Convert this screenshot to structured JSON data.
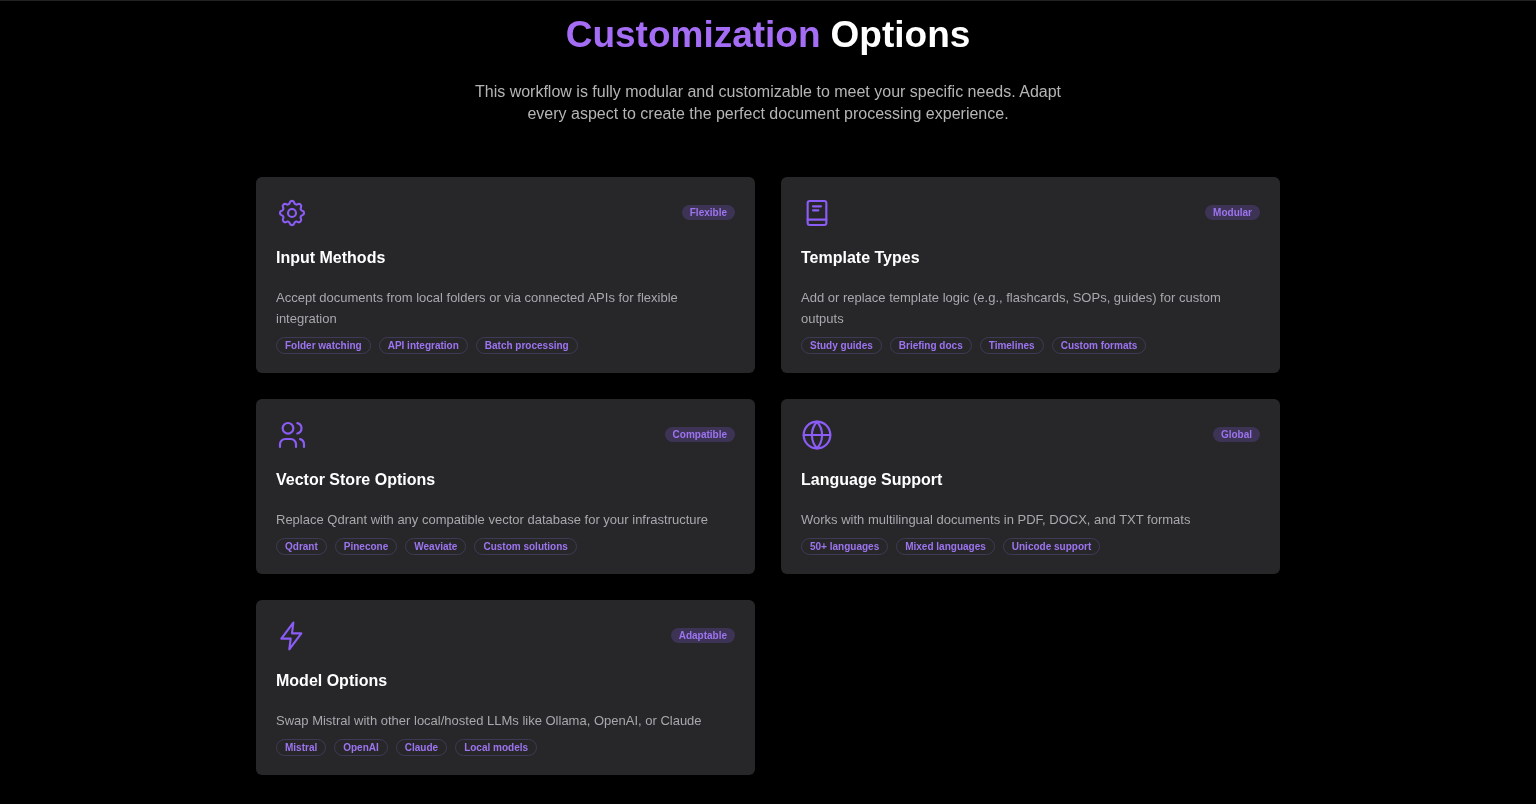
{
  "heading": {
    "highlight": "Customization",
    "rest": "Options"
  },
  "intro": "This workflow is fully modular and customizable to meet your specific needs. Adapt every aspect to create the perfect document processing experience.",
  "cards": [
    {
      "kind": "gear",
      "badge": "Flexible",
      "title": "Input Methods",
      "description": "Accept documents from local folders or via connected APIs for flexible integration",
      "tags": [
        "Folder watching",
        "API integration",
        "Batch processing"
      ]
    },
    {
      "kind": "book",
      "badge": "Modular",
      "title": "Template Types",
      "description": "Add or replace template logic (e.g., flashcards, SOPs, guides) for custom outputs",
      "tags": [
        "Study guides",
        "Briefing docs",
        "Timelines",
        "Custom formats"
      ]
    },
    {
      "kind": "users",
      "badge": "Compatible",
      "title": "Vector Store Options",
      "description": "Replace Qdrant with any compatible vector database for your infrastructure",
      "tags": [
        "Qdrant",
        "Pinecone",
        "Weaviate",
        "Custom solutions"
      ]
    },
    {
      "kind": "globe",
      "badge": "Global",
      "title": "Language Support",
      "description": "Works with multilingual documents in PDF, DOCX, and TXT formats",
      "tags": [
        "50+ languages",
        "Mixed languages",
        "Unicode support"
      ]
    },
    {
      "kind": "bolt",
      "badge": "Adaptable",
      "title": "Model Options",
      "description": "Swap Mistral with other local/hosted LLMs like Ollama, OpenAI, or Claude",
      "tags": [
        "Mistral",
        "OpenAI",
        "Claude",
        "Local models"
      ]
    }
  ]
}
